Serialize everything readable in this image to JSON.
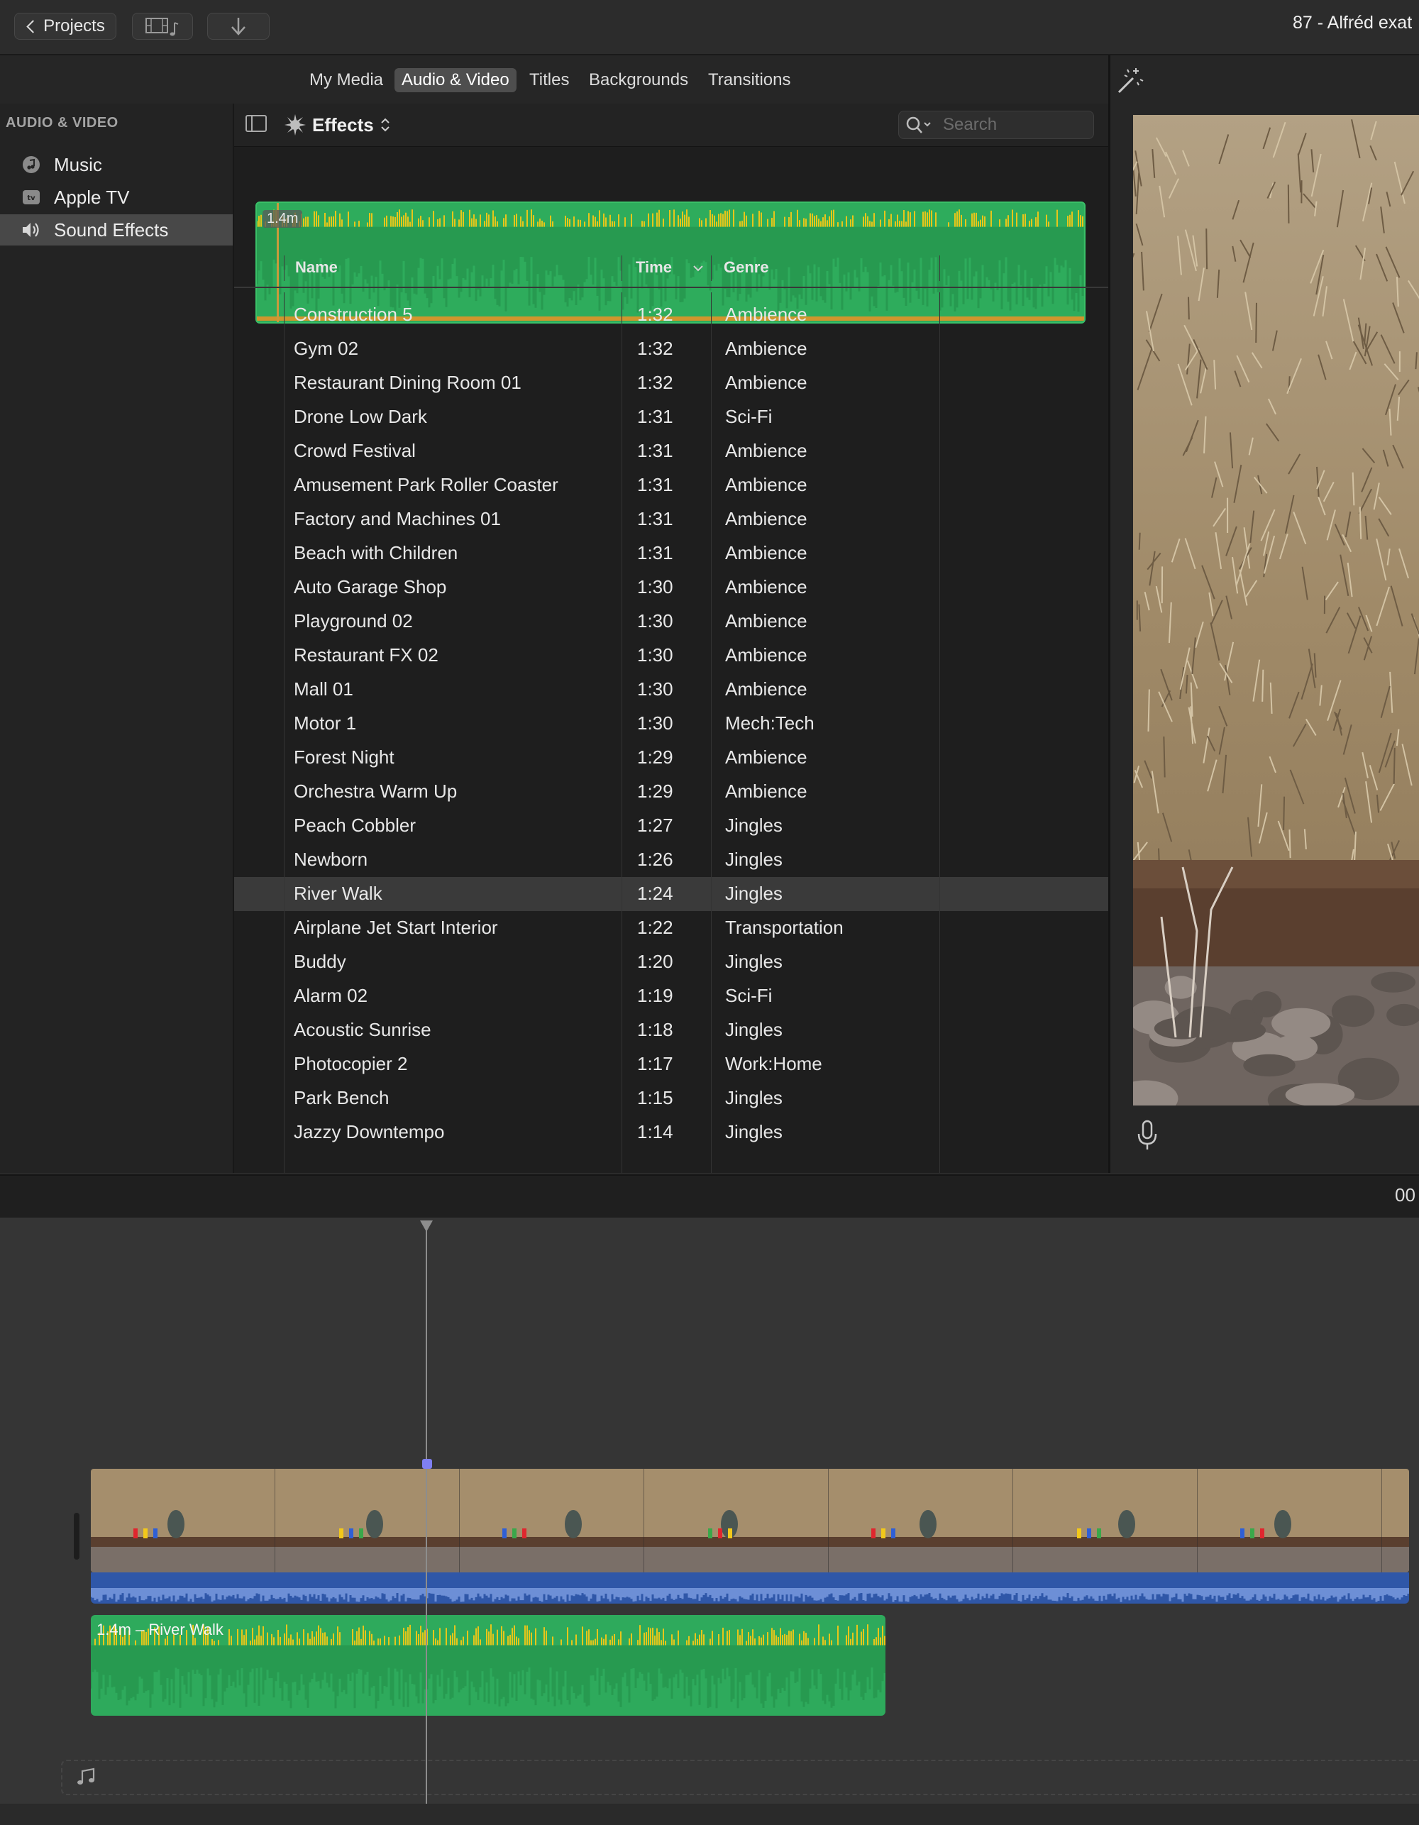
{
  "toolbar": {
    "back_label": "Projects",
    "document_title": "87 - Alfréd exat"
  },
  "browser": {
    "tabs": [
      "My Media",
      "Audio & Video",
      "Titles",
      "Backgrounds",
      "Transitions"
    ],
    "active_tab": "Audio & Video",
    "sidebar": {
      "heading": "AUDIO & VIDEO",
      "items": [
        {
          "label": "Music",
          "icon": "music-note-icon",
          "selected": false
        },
        {
          "label": "Apple TV",
          "icon": "apple-tv-icon",
          "selected": false
        },
        {
          "label": "Sound Effects",
          "icon": "speaker-icon",
          "selected": true
        }
      ]
    },
    "content": {
      "popup_label": "Effects",
      "search_placeholder": "Search",
      "preview_duration": "1.4m",
      "columns": {
        "name": "Name",
        "time": "Time",
        "genre": "Genre"
      },
      "sort_column": "Time",
      "rows": [
        {
          "name": "Construction 5",
          "time": "1:32",
          "genre": "Ambience"
        },
        {
          "name": "Gym 02",
          "time": "1:32",
          "genre": "Ambience"
        },
        {
          "name": "Restaurant Dining Room 01",
          "time": "1:32",
          "genre": "Ambience"
        },
        {
          "name": "Drone Low Dark",
          "time": "1:31",
          "genre": "Sci-Fi"
        },
        {
          "name": "Crowd Festival",
          "time": "1:31",
          "genre": "Ambience"
        },
        {
          "name": "Amusement Park Roller Coaster",
          "time": "1:31",
          "genre": "Ambience"
        },
        {
          "name": "Factory and Machines 01",
          "time": "1:31",
          "genre": "Ambience"
        },
        {
          "name": "Beach with Children",
          "time": "1:31",
          "genre": "Ambience"
        },
        {
          "name": "Auto Garage Shop",
          "time": "1:30",
          "genre": "Ambience"
        },
        {
          "name": "Playground 02",
          "time": "1:30",
          "genre": "Ambience"
        },
        {
          "name": "Restaurant FX 02",
          "time": "1:30",
          "genre": "Ambience"
        },
        {
          "name": "Mall 01",
          "time": "1:30",
          "genre": "Ambience"
        },
        {
          "name": "Motor 1",
          "time": "1:30",
          "genre": "Mech:Tech"
        },
        {
          "name": "Forest Night",
          "time": "1:29",
          "genre": "Ambience"
        },
        {
          "name": "Orchestra Warm Up",
          "time": "1:29",
          "genre": "Ambience"
        },
        {
          "name": "Peach Cobbler",
          "time": "1:27",
          "genre": "Jingles"
        },
        {
          "name": "Newborn",
          "time": "1:26",
          "genre": "Jingles"
        },
        {
          "name": "River Walk",
          "time": "1:24",
          "genre": "Jingles",
          "selected": true
        },
        {
          "name": "Airplane Jet Start Interior",
          "time": "1:22",
          "genre": "Transportation"
        },
        {
          "name": "Buddy",
          "time": "1:20",
          "genre": "Jingles"
        },
        {
          "name": "Alarm 02",
          "time": "1:19",
          "genre": "Sci-Fi"
        },
        {
          "name": "Acoustic Sunrise",
          "time": "1:18",
          "genre": "Jingles"
        },
        {
          "name": "Photocopier 2",
          "time": "1:17",
          "genre": "Work:Home"
        },
        {
          "name": "Park Bench",
          "time": "1:15",
          "genre": "Jingles"
        },
        {
          "name": "Jazzy Downtempo",
          "time": "1:14",
          "genre": "Jingles"
        }
      ]
    }
  },
  "timeline": {
    "timecode": "00",
    "sound_clip_label": "1.4m – River Walk"
  },
  "colors": {
    "audio_green": "#2eaa5c",
    "waveform_yellow": "#e8c619",
    "video_audio_blue": "#2f57a8",
    "selection_gray": "#3a3a3a"
  }
}
